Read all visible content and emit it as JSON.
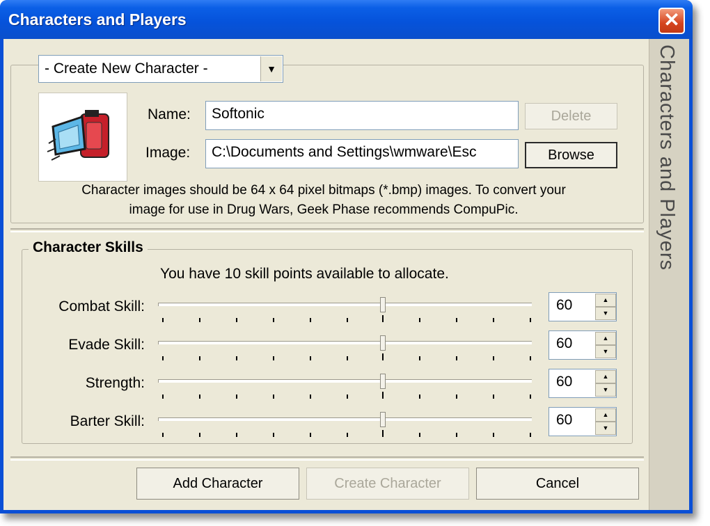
{
  "window": {
    "title": "Characters and Players",
    "close_icon": "close-icon"
  },
  "sidebar": {
    "label": "Characters and Players"
  },
  "character_select": {
    "selected": "- Create New Character -"
  },
  "form": {
    "name_label": "Name:",
    "name_value": "Softonic",
    "image_label": "Image:",
    "image_value": "C:\\Documents and Settings\\wmware\\Esc",
    "delete_label": "Delete",
    "browse_label": "Browse"
  },
  "note": {
    "line1": "Character images should be 64 x 64 pixel bitmaps (*.bmp) images.  To convert your",
    "line2": "image for use in Drug Wars, Geek Phase recommends CompuPic."
  },
  "skills": {
    "title": "Character Skills",
    "points_text": "You have 10 skill points available to allocate.",
    "items": [
      {
        "label": "Combat Skill:",
        "value": "60"
      },
      {
        "label": "Evade Skill:",
        "value": "60"
      },
      {
        "label": "Strength:",
        "value": "60"
      },
      {
        "label": "Barter Skill:",
        "value": "60"
      }
    ],
    "slider_min": 0,
    "slider_max": 100,
    "slider_fraction": 0.6
  },
  "buttons": {
    "add": "Add Character",
    "create": "Create Character",
    "cancel": "Cancel"
  },
  "colors": {
    "titlebar": "#0a4fd6",
    "dialog_bg": "#ece9d8",
    "close_button": "#d5441f"
  }
}
